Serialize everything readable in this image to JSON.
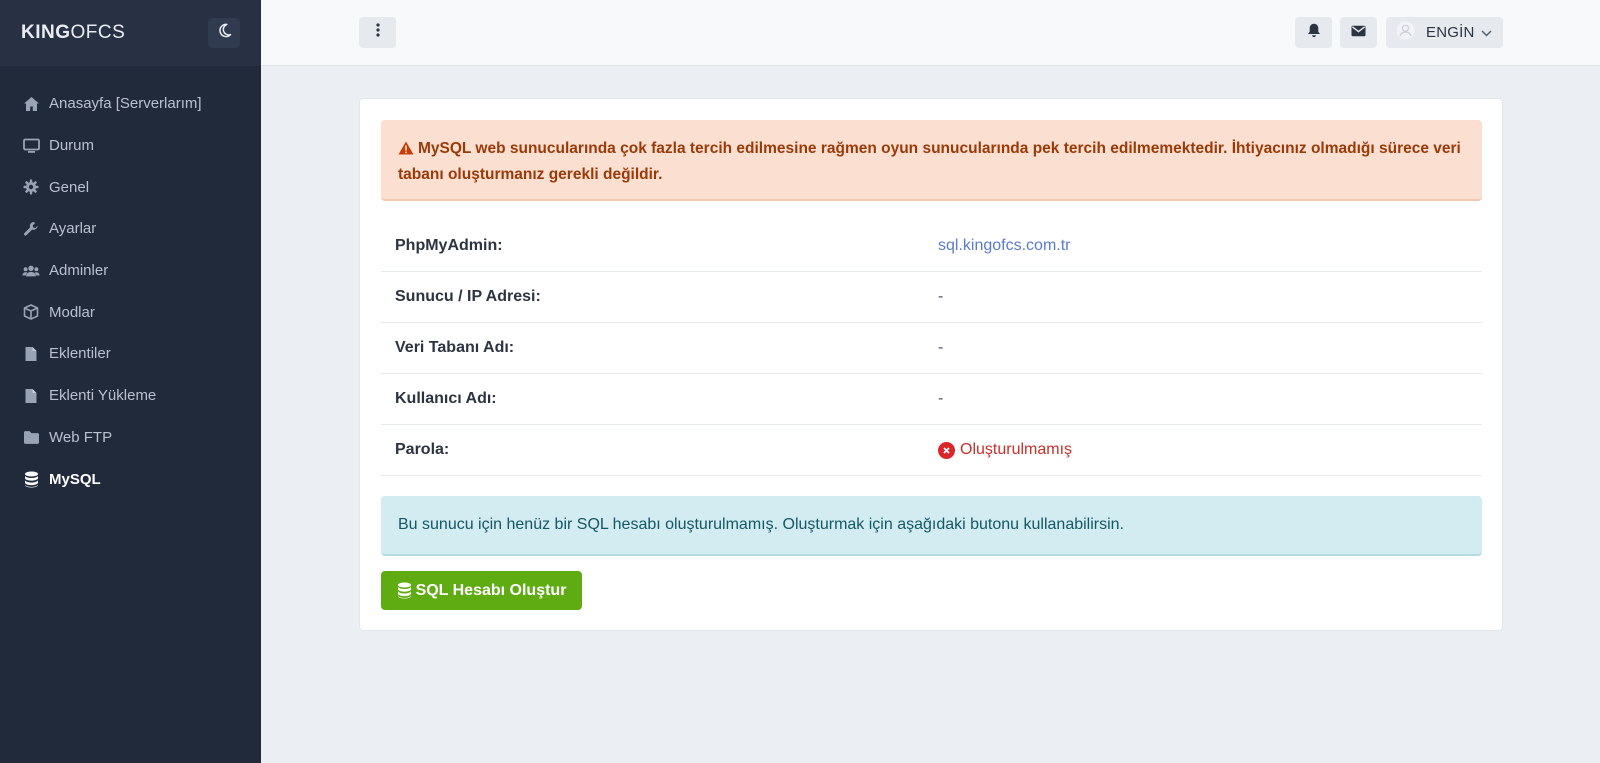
{
  "brand": {
    "bold": "KING",
    "light": "OFCS"
  },
  "sidebar": {
    "items": [
      {
        "label": "Anasayfa [Serverlarım]",
        "icon": "home-icon"
      },
      {
        "label": "Durum",
        "icon": "monitor-icon"
      },
      {
        "label": "Genel",
        "icon": "gear-icon"
      },
      {
        "label": "Ayarlar",
        "icon": "wrench-icon"
      },
      {
        "label": "Adminler",
        "icon": "users-icon"
      },
      {
        "label": "Modlar",
        "icon": "cube-icon"
      },
      {
        "label": "Eklentiler",
        "icon": "file-icon"
      },
      {
        "label": "Eklenti Yükleme",
        "icon": "file-icon"
      },
      {
        "label": "Web FTP",
        "icon": "folder-icon"
      },
      {
        "label": "MySQL",
        "icon": "database-icon",
        "active": true
      }
    ]
  },
  "topbar": {
    "user_name": "ENGİN"
  },
  "warning": {
    "text": "MySQL web sunucularında çok fazla tercih edilmesine rağmen oyun sunucularında pek tercih edilmemektedir. İhtiyacınız olmadığı sürece veri tabanı oluşturmanız gerekli değildir."
  },
  "info": {
    "rows": [
      {
        "label": "PhpMyAdmin:",
        "value": "sql.kingofcs.com.tr"
      },
      {
        "label": "Sunucu / IP Adresi:",
        "value": "-"
      },
      {
        "label": "Veri Tabanı Adı:",
        "value": "-"
      },
      {
        "label": "Kullanıcı Adı:",
        "value": "-"
      },
      {
        "label": "Parola:",
        "value": "Oluşturulmamış"
      }
    ]
  },
  "notice": {
    "text": "Bu sunucu için henüz bir SQL hesabı oluşturulmamış. Oluşturmak için aşağıdaki butonu kullanabilirsin."
  },
  "actions": {
    "create_label": "SQL Hesabı Oluştur"
  },
  "colors": {
    "sidebar_bg": "#212a3a",
    "warning_bg": "#fbdfd1",
    "info_bg": "#d2ecf1",
    "button_green": "#5fab12",
    "link_blue": "#5b7cc9",
    "error_red": "#d9262b"
  }
}
